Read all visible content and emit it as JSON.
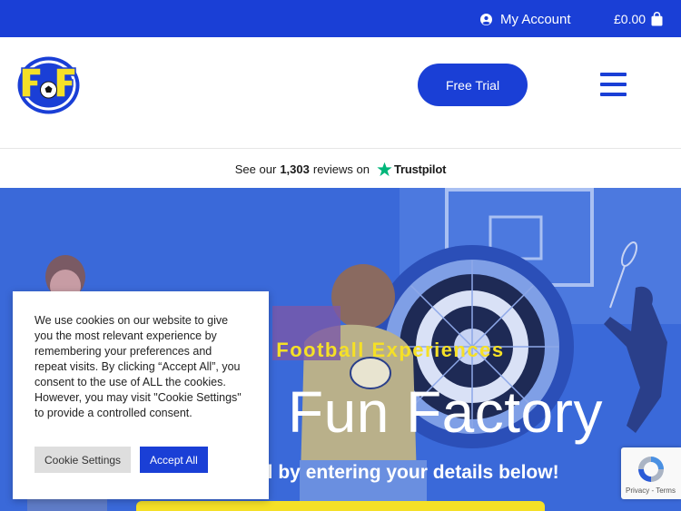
{
  "topbar": {
    "account_label": "My Account",
    "cart_total": "£0.00"
  },
  "header": {
    "logo_letters": "FF",
    "free_trial_label": "Free Trial"
  },
  "trustpilot": {
    "prefix": "See our",
    "count": "1,303",
    "suffix": "reviews on",
    "brand": "Trustpilot"
  },
  "hero": {
    "tagline": "ue Football Experiences",
    "title": "l Fun Factory",
    "subtitle": "trial by entering your details below!"
  },
  "cookie": {
    "text": "We use cookies on our website to give you the most relevant experience by remembering your preferences and repeat visits. By clicking “Accept All”, you consent to the use of ALL the cookies. However, you may visit \"Cookie Settings\" to provide a controlled consent.",
    "settings_label": "Cookie Settings",
    "accept_label": "Accept All"
  },
  "recaptcha": {
    "label": "Privacy - Terms"
  },
  "colors": {
    "brand_blue": "#1a3fd6",
    "accent_yellow": "#f5e027",
    "trustpilot_green": "#00b67a"
  },
  "icons": {
    "account": "user-circle-icon",
    "cart": "shopping-bag-icon",
    "menu": "hamburger-icon",
    "trustpilot": "star-icon",
    "recaptcha": "recaptcha-icon"
  }
}
